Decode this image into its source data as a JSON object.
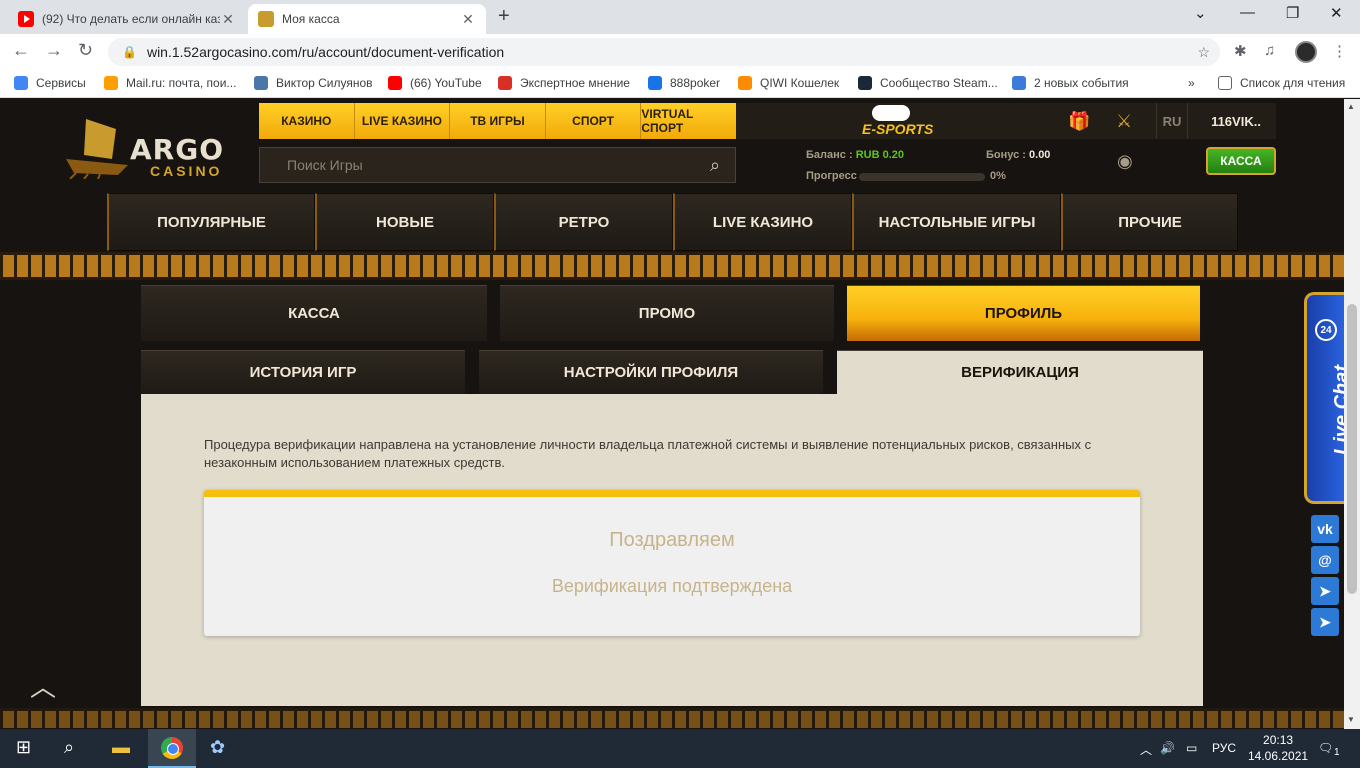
{
  "browser": {
    "tabs": [
      {
        "title": "(92) Что делать если онлайн каз",
        "active": false
      },
      {
        "title": "Моя касса",
        "active": true
      }
    ],
    "url": "win.1.52argocasino.com/ru/account/document-verification",
    "bookmarks": [
      {
        "label": "Сервисы",
        "color": "#4285f4"
      },
      {
        "label": "Mail.ru: почта, пои...",
        "color": "#ff9e00"
      },
      {
        "label": "Виктор Силуянов",
        "color": "#4a76a8"
      },
      {
        "label": "(66) YouTube",
        "color": "#ff0000"
      },
      {
        "label": "Экспертное мнение",
        "color": "#d93025"
      },
      {
        "label": "888poker",
        "color": "#1a73e8"
      },
      {
        "label": "QIWI Кошелек",
        "color": "#ff8c00"
      },
      {
        "label": "Сообщество Steam...",
        "color": "#1b2838"
      },
      {
        "label": "2 новых события",
        "color": "#3c7bd9"
      }
    ],
    "bookmarks_overflow": "»",
    "reading_list": "Список для чтения"
  },
  "site": {
    "logo": {
      "argo": "ARGO",
      "casino": "CASINO"
    },
    "top_nav": [
      "КАЗИНО",
      "LIVE КАЗИНО",
      "ТВ ИГРЫ",
      "СПОРТ",
      "VIRTUAL СПОРТ"
    ],
    "esports_label": "E-SPORTS",
    "language": "RU",
    "username": "116VIK..",
    "search_placeholder": "Поиск Игры",
    "balance": {
      "label": "Баланс :",
      "value": "RUB 0.20"
    },
    "bonus": {
      "label": "Бонус :",
      "value": "0.00"
    },
    "progress": {
      "label": "Прогресс",
      "value": "0%",
      "fraction": 0
    },
    "cash_button": "КАССА",
    "categories": [
      "ПОПУЛЯРНЫЕ",
      "НОВЫЕ",
      "РЕТРО",
      "LIVE КАЗИНО",
      "НАСТОЛЬНЫЕ ИГРЫ",
      "ПРОЧИЕ"
    ],
    "account_tabs": [
      {
        "label": "КАССА",
        "active": false
      },
      {
        "label": "ПРОМО",
        "active": false
      },
      {
        "label": "ПРОФИЛЬ",
        "active": true
      }
    ],
    "profile_tabs": [
      {
        "label": "ИСТОРИЯ ИГР",
        "active": false
      },
      {
        "label": "НАСТРОЙКИ ПРОФИЛЯ",
        "active": false
      },
      {
        "label": "ВЕРИФИКАЦИЯ",
        "active": true
      }
    ],
    "verification": {
      "description": "Процедура верификации направлена на установление личности владельца платежной системы и выявление потенциальных рисков, связанных с незаконным использованием платежных средств.",
      "title": "Поздравляем",
      "status": "Верификация подтверждена"
    },
    "live_chat": {
      "label": "Live Chat",
      "badge": "24"
    },
    "social": [
      "VK",
      "@",
      "telegram",
      "telegram"
    ]
  },
  "taskbar": {
    "language": "РУС",
    "time": "20:13",
    "date": "14.06.2021",
    "notifications": "1"
  },
  "colors": {
    "accent": "#f4bf0e",
    "success": "#5ec51d",
    "panel": "#e2dccc"
  }
}
